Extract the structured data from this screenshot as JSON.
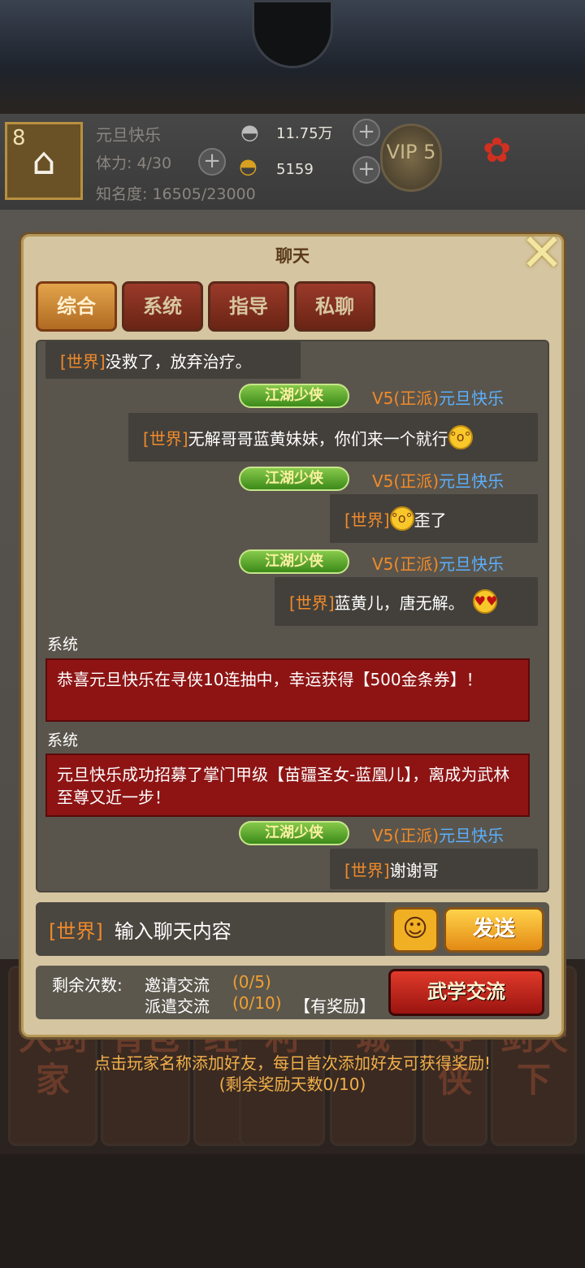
{
  "player": {
    "level": "8",
    "name": "元旦快乐",
    "stamina": "体力: 4/30",
    "fame": "知名度: 16505/23000",
    "silver": "11.75万",
    "gold": "5159",
    "vip": "VIP 5"
  },
  "nav": [
    "大剑家",
    "背包",
    "经阁",
    "利",
    "城",
    "寻侠",
    "剑天下"
  ],
  "chat": {
    "title": "聊天",
    "tabs": [
      "综合",
      "系统",
      "指导",
      "私聊"
    ],
    "world_tag": "[世界]",
    "title_badge": "江湖少侠",
    "sender": {
      "rank": "V5(正派)",
      "name": "元旦快乐"
    },
    "system_label": "系统",
    "messages": [
      {
        "text": "没救了，放弃治疗。"
      },
      {
        "text": "无解哥哥蓝黄妹妹，你们来一个就行"
      },
      {
        "text": "歪了"
      },
      {
        "text": "蓝黄儿，唐无解。"
      },
      {
        "text": "恭喜元旦快乐在寻侠10连抽中，幸运获得【500金条券】！"
      },
      {
        "text": "元旦快乐成功招募了掌门甲级【苗疆圣女-蓝凰儿】，离成为武林至尊又近一步！"
      },
      {
        "text": "谢谢哥"
      }
    ]
  },
  "input": {
    "channel": "[世界]",
    "placeholder": "输入聊天内容",
    "send_label": "发送"
  },
  "quota": {
    "remaining_label": "剩余次数:",
    "invite_label": "邀请交流",
    "invite_count": "(0/5)",
    "dispatch_label": "派遣交流",
    "dispatch_count": "(0/10)",
    "reward_note": "【有奖励】",
    "button_label": "武学交流"
  },
  "hint": {
    "line1": "点击玩家名称添加好友，每日首次添加好友可获得奖励!",
    "line2": "(剩余奖励天数0/10)"
  }
}
